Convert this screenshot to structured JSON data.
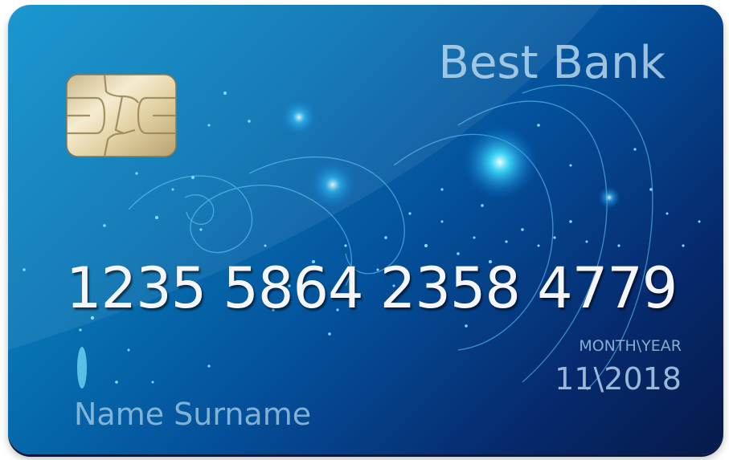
{
  "card": {
    "bank_name": "Best Bank",
    "card_number": "1235 5864 2358 4779",
    "expiry_label": "MONTH\\YEAR",
    "expiry_value": "11\\2018",
    "holder_name": "Name Surname"
  },
  "colors": {
    "card_light": "#0a8fcc",
    "card_dark": "#061a4a",
    "number_text": "#f4f6fa",
    "chip_gold": "#e6d7a8"
  },
  "icons": [
    "chip-icon"
  ]
}
